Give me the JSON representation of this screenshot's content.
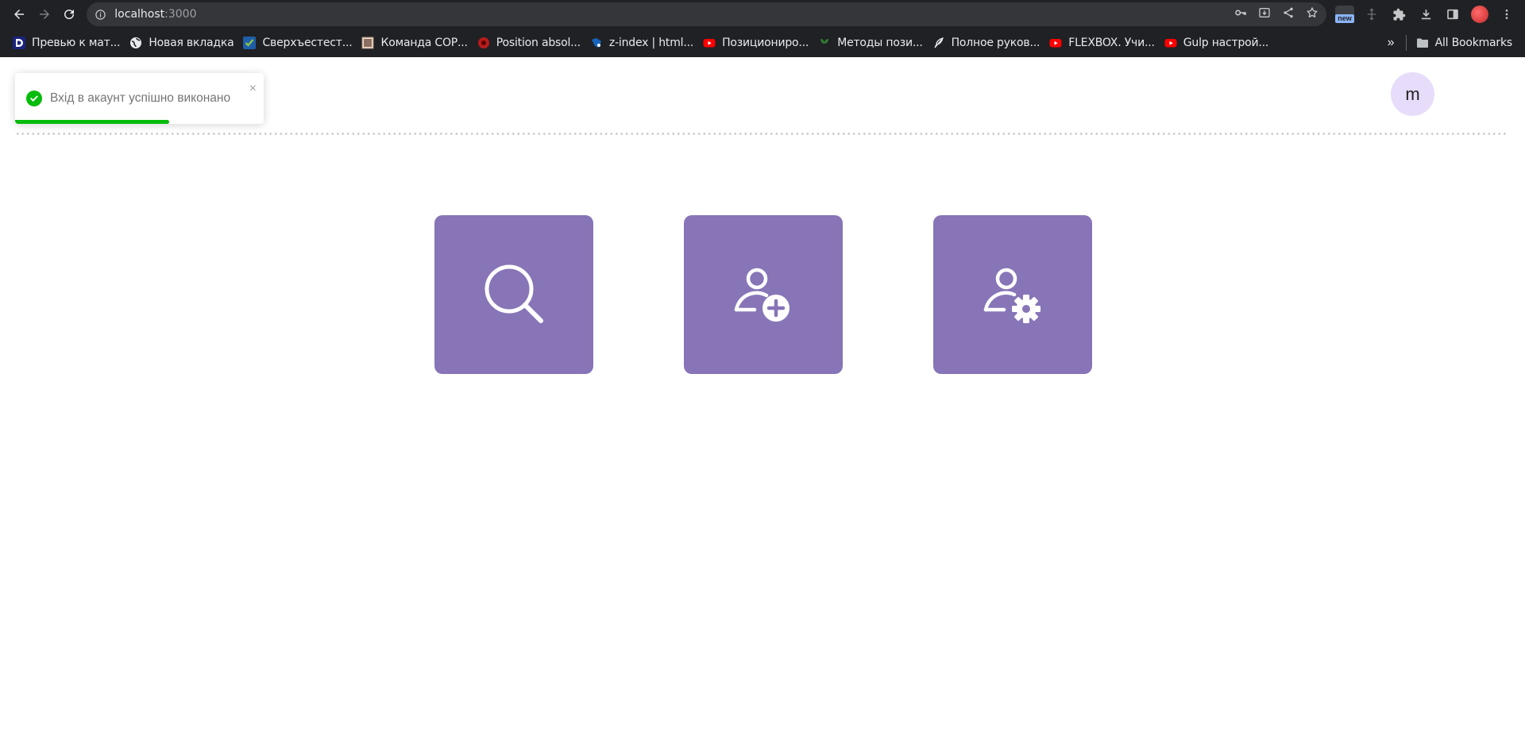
{
  "browser": {
    "url_host": "localhost",
    "url_port": ":3000",
    "extension_badge": "new",
    "bookmarks": [
      {
        "label": "Превью к мат...",
        "icon": "dark-square-icon"
      },
      {
        "label": "Новая вкладка",
        "icon": "globe-icon"
      },
      {
        "label": "Сверхъестест...",
        "icon": "checkmark-shield-icon"
      },
      {
        "label": "Команда СОР...",
        "icon": "image-icon"
      },
      {
        "label": "Position absol...",
        "icon": "red-circle-icon"
      },
      {
        "label": "z-index | html...",
        "icon": "blue-mark-icon"
      },
      {
        "label": "Позициониро...",
        "icon": "youtube-icon"
      },
      {
        "label": "Методы пози...",
        "icon": "green-plant-icon"
      },
      {
        "label": "Полное руков...",
        "icon": "feather-icon"
      },
      {
        "label": "FLEXBOX. Учи...",
        "icon": "youtube-icon"
      },
      {
        "label": "Gulp настрой...",
        "icon": "youtube-icon"
      }
    ],
    "bookmarks_more": "»",
    "all_bookmarks": "All Bookmarks"
  },
  "toast": {
    "message": "Вхід в акаунт успішно виконано",
    "close": "×",
    "progress": 0.62,
    "color": "#07bc0c"
  },
  "avatar": {
    "initial": "m",
    "color": "#e7dcfa"
  },
  "tiles": [
    {
      "name": "search",
      "icon": "search-icon"
    },
    {
      "name": "add-user",
      "icon": "user-plus-icon"
    },
    {
      "name": "user-settings",
      "icon": "user-gear-icon"
    }
  ],
  "colors": {
    "tile": "#8775b7",
    "chrome_bg": "#202124"
  }
}
